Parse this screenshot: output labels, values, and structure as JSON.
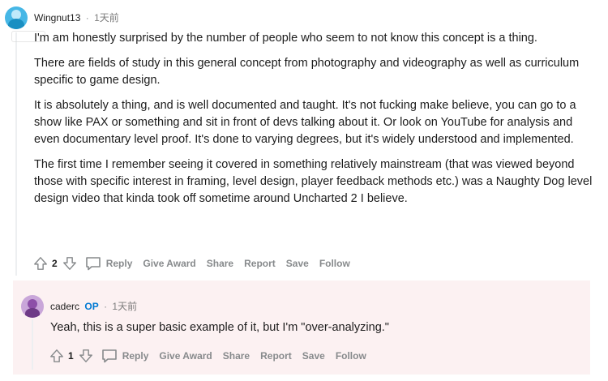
{
  "comments": [
    {
      "username": "Wingnut13",
      "separator": "·",
      "time": "1天前",
      "paragraphs": [
        "I'm am honestly surprised by the number of people who seem to not know this concept is a thing.",
        "There are fields of study in this general concept from photography and videography as well as curriculum specific to game design.",
        "It is absolutely a thing, and is well documented and taught. It's not fucking make believe, you can go to a show like PAX or something and sit in front of devs talking about it. Or look on YouTube for analysis and even documentary level proof. It's done to varying degrees, but it's widely understood and implemented.",
        "The first time I remember seeing it covered in something relatively mainstream (that was viewed beyond those with specific interest in framing, level design, player feedback methods etc.) was a Naughty Dog level design video that kinda took off sometime around Uncharted 2 I believe."
      ],
      "score": "2",
      "actions": {
        "reply": "Reply",
        "give_award": "Give Award",
        "share": "Share",
        "report": "Report",
        "save": "Save",
        "follow": "Follow"
      }
    },
    {
      "username": "caderc",
      "op_badge": "OP",
      "separator": "·",
      "time": "1天前",
      "paragraphs": [
        "Yeah, this is a super basic example of it, but I'm \"over-analyzing.\""
      ],
      "score": "1",
      "actions": {
        "reply": "Reply",
        "give_award": "Give Award",
        "share": "Share",
        "report": "Report",
        "save": "Save",
        "follow": "Follow"
      }
    }
  ],
  "icons": {
    "upvote": "arrow-up-icon",
    "downvote": "arrow-down-icon",
    "reply": "comment-bubble-icon"
  },
  "colors": {
    "op_badge": "#0079d3",
    "highlight_bg": "#fcf1f2",
    "meta_gray": "#878a8c"
  }
}
